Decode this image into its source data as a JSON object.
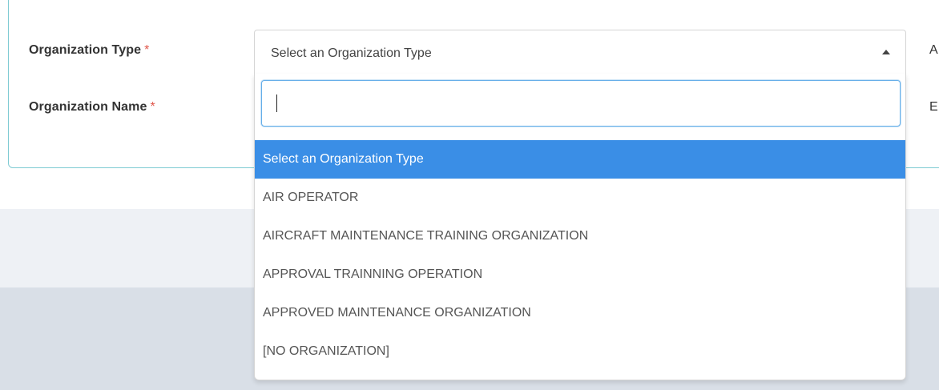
{
  "form": {
    "org_type_label": "Organization Type",
    "org_name_label": "Organization Name",
    "required_mark": "*",
    "right_label_1": "A",
    "right_label_2": "E"
  },
  "select": {
    "value": "Select an Organization Type",
    "search_value": ""
  },
  "dropdown": {
    "options": [
      "Select an Organization Type",
      "AIR OPERATOR",
      "AIRCRAFT MAINTENANCE TRAINING ORGANIZATION",
      "APPROVAL TRAINNING OPERATION",
      "APPROVED MAINTENANCE ORGANIZATION",
      "[NO ORGANIZATION]"
    ],
    "selected_index": 0
  },
  "colors": {
    "highlight": "#3a8ee6",
    "required": "#e0564a",
    "card_border": "#7ecbd3",
    "focus_border": "#66afe9"
  },
  "icons": {
    "caret": "caret-up-icon"
  }
}
